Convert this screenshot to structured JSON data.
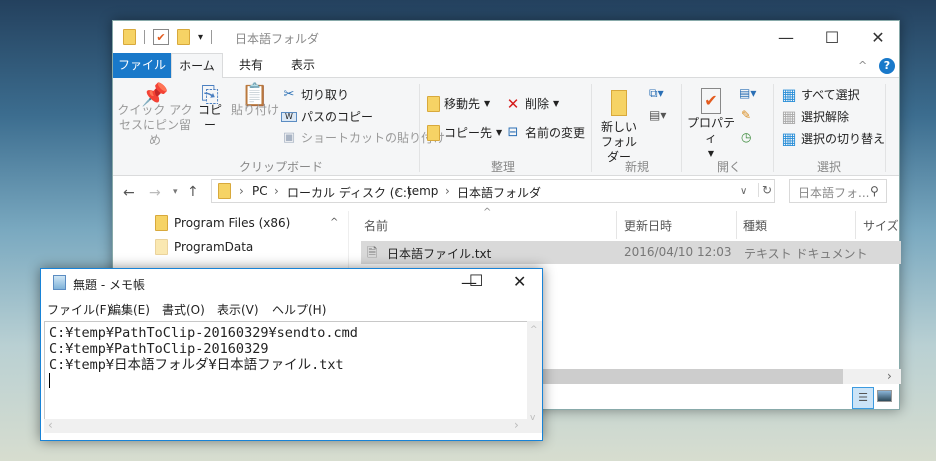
{
  "explorer": {
    "title": "日本語フォルダ",
    "tabs": [
      "ファイル",
      "ホーム",
      "共有",
      "表示"
    ],
    "clipboard": {
      "pin": "クイック アクセスにピン留め",
      "copy": "コピー",
      "paste": "貼り付け",
      "cut": "切り取り",
      "copy_path": "パスのコピー",
      "paste_shortcut": "ショートカットの貼り付け",
      "label": "クリップボード"
    },
    "organize": {
      "move_to": "移動先",
      "copy_to": "コピー先",
      "delete": "削除",
      "rename": "名前の変更",
      "label": "整理"
    },
    "new": {
      "new_folder": "新しいフォルダー",
      "label": "新規"
    },
    "open": {
      "properties": "プロパティ",
      "label": "開く"
    },
    "select": {
      "select_all": "すべて選択",
      "select_none": "選択解除",
      "invert": "選択の切り替え",
      "label": "選択"
    },
    "breadcrumb": [
      "PC",
      "ローカル ディスク (C:)",
      "temp",
      "日本語フォルダ"
    ],
    "search_placeholder": "日本語フォ...",
    "nav": [
      "Program Files (x86)",
      "ProgramData"
    ],
    "columns": [
      "名前",
      "更新日時",
      "種類",
      "サイズ"
    ],
    "files": [
      {
        "name": "日本語ファイル.txt",
        "modified": "2016/04/10 12:03",
        "type": "テキスト ドキュメント"
      }
    ]
  },
  "notepad": {
    "title": "無題 - メモ帳",
    "menu": [
      "ファイル(F)",
      "編集(E)",
      "書式(O)",
      "表示(V)",
      "ヘルプ(H)"
    ],
    "lines": [
      "C:¥temp¥PathToClip-20160329¥sendto.cmd",
      "C:¥temp¥PathToClip-20160329",
      "C:¥temp¥日本語フォルダ¥日本語ファイル.txt"
    ]
  }
}
